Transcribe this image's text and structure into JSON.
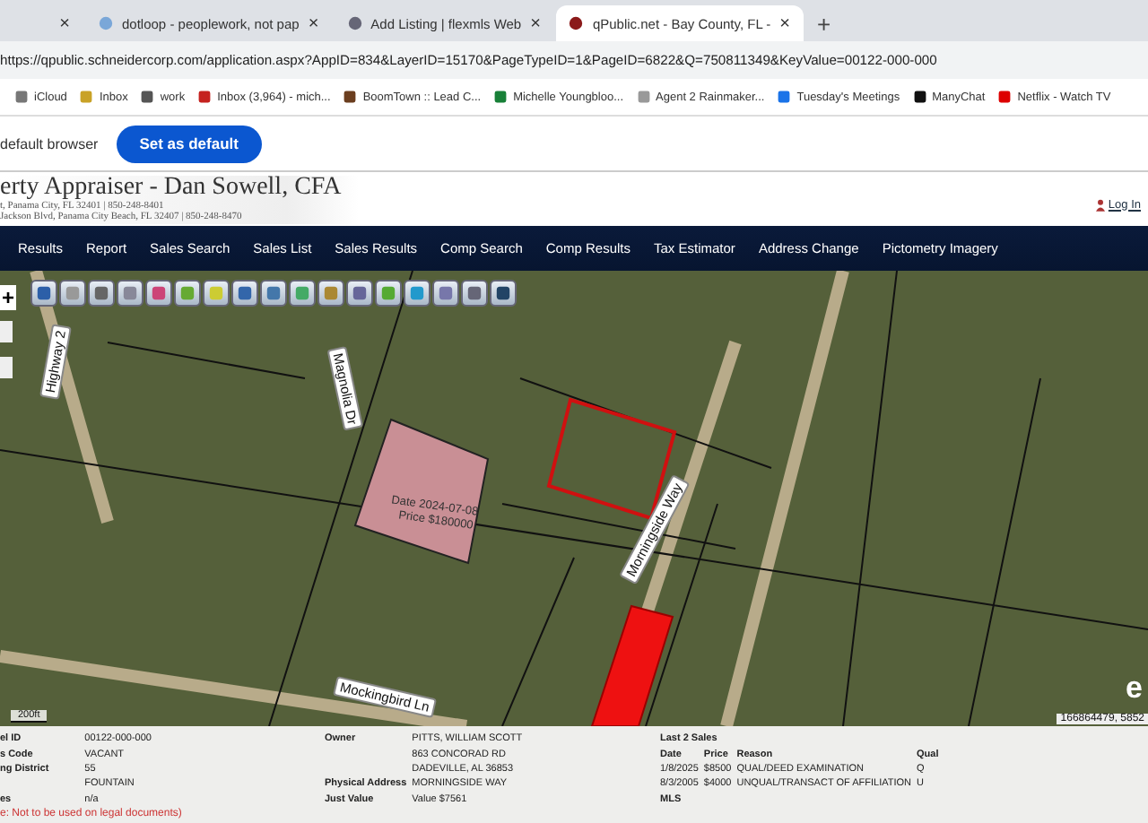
{
  "browser": {
    "tabs": [
      {
        "close": "×",
        "selected": false
      },
      {
        "title": "dotloop - peoplework, not pap",
        "close": "×",
        "selected": false
      },
      {
        "title": "Add Listing | flexmls Web",
        "close": "×",
        "selected": false
      },
      {
        "title": "qPublic.net - Bay County, FL - ",
        "close": "×",
        "selected": true
      }
    ],
    "new_tab": "+",
    "url": "https://qpublic.schneidercorp.com/application.aspx?AppID=834&LayerID=15170&PageTypeID=1&PageID=6822&Q=750811349&KeyValue=00122-000-000",
    "bookmarks": [
      "iCloud",
      "Inbox",
      "work",
      "Inbox (3,964) - mich...",
      "BoomTown :: Lead C...",
      "Michelle Youngbloo...",
      "Agent 2 Rainmaker...",
      "Tuesday's Meetings",
      "ManyChat",
      "Netflix - Watch TV"
    ]
  },
  "default_bar": {
    "text": "default browser",
    "button": "Set as default"
  },
  "site": {
    "title": "erty Appraiser - Dan Sowell, CFA",
    "address_1": "t, Panama City, FL 32401 | 850-248-8401",
    "address_2": "Jackson Blvd, Panama City Beach, FL 32407 | 850-248-8470",
    "login": "Log In",
    "nav": [
      "Results",
      "Report",
      "Sales Search",
      "Sales List",
      "Sales Results",
      "Comp Search",
      "Comp Results",
      "Tax Estimator",
      "Address Change",
      "Pictometry Imagery"
    ]
  },
  "map": {
    "zoom_in": "+",
    "labels": [
      {
        "kind": "road",
        "text": "Highway 2"
      },
      {
        "kind": "road",
        "text": "Magnolia Dr"
      },
      {
        "kind": "sale",
        "text": "Date 2024-07-08"
      },
      {
        "kind": "sale",
        "text": "Price $180000"
      },
      {
        "kind": "road",
        "text": "Morningside Way"
      },
      {
        "kind": "road",
        "text": "Mockingbird Ln"
      }
    ],
    "scale": "200ft",
    "coords": "166864479, 5852",
    "logo": "e"
  },
  "info": {
    "parcel": [
      {
        "label": "el ID",
        "value": "00122-000-000"
      },
      {
        "label": "s Code",
        "value": "VACANT"
      },
      {
        "label": "ng District",
        "value": "55"
      },
      {
        "value": "FOUNTAIN"
      },
      {
        "label": "es",
        "value": "n/a"
      }
    ],
    "owner": [
      {
        "label": "Owner",
        "value": "PITTS, WILLIAM SCOTT"
      },
      {
        "value": "863 CONCORAD RD"
      },
      {
        "value": "DADEVILLE, AL 36853"
      },
      {
        "label": "Physical Address",
        "value": "MORNINGSIDE WAY"
      },
      {
        "label": "Just Value",
        "value": "Value $7561"
      }
    ],
    "sales_title": "Last 2 Sales",
    "sales_columns": [
      "Date",
      "Price",
      "Reason",
      "Qual"
    ],
    "sales": [
      [
        "1/8/2025",
        "$8500",
        "QUAL/DEED EXAMINATION",
        "Q"
      ],
      [
        "8/3/2005",
        "$4000",
        "UNQUAL/TRANSACT OF AFFILIATION",
        "U"
      ]
    ],
    "mls_label": "MLS",
    "note": "e: Not to be used on legal documents)"
  }
}
